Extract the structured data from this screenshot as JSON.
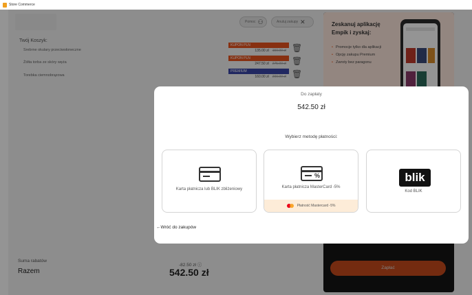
{
  "window": {
    "title": "Store Commerce"
  },
  "header": {
    "help_label": "Pomoc",
    "cancel_label": "Anuluj zakupy"
  },
  "cart": {
    "title": "Twój Koszyk:",
    "items": [
      {
        "name": "Srebrne okulary przeciwsłoneczne",
        "badge": "KUPON PLN",
        "badge_color": "#e8541e",
        "price": "135.00 zł",
        "old_price": "150.00 zł"
      },
      {
        "name": "Żółta torba ze skóry węża",
        "badge": "KUPON PLN",
        "badge_color": "#e8541e",
        "price": "247.50 zł",
        "old_price": "275.00 zł"
      },
      {
        "name": "Torebka ciemnobrązowa",
        "badge": "PREMIUM",
        "badge_color": "#3a46a8",
        "price": "160.00 zł",
        "old_price": "200.00 zł"
      }
    ]
  },
  "summary": {
    "discounts_label": "Suma rabatów",
    "discounts_value": "-82.50 zł",
    "total_label": "Razem",
    "total_value": "542.50 zł"
  },
  "promo": {
    "heading": "Zeskanuj aplikację Empik i zyskaj:",
    "bullets": [
      "Promocje tylko dla aplikacji",
      "Opcję zakupu Premium",
      "Zwroty bez paragonu"
    ],
    "pay_label": "Zapłać"
  },
  "modal": {
    "due_label": "Do zapłaty",
    "due_amount": "542.50 zł",
    "method_title": "Wybierz metodę płatności:",
    "methods": [
      {
        "label": "Karta płatnicza lub BLIK zbliżeniowy"
      },
      {
        "label": "Karta płatnicza MasterCard -5%",
        "promo": "Płatność Mastercard -5%"
      },
      {
        "label": "Kod BLIK",
        "logo": "blik"
      }
    ],
    "back_label": "←Wróć do zakupów"
  },
  "colors": {
    "accent": "#e8541e",
    "premium": "#3a46a8",
    "promo_bg": "#fde7dc",
    "promo_strip": "#fdecd8"
  }
}
